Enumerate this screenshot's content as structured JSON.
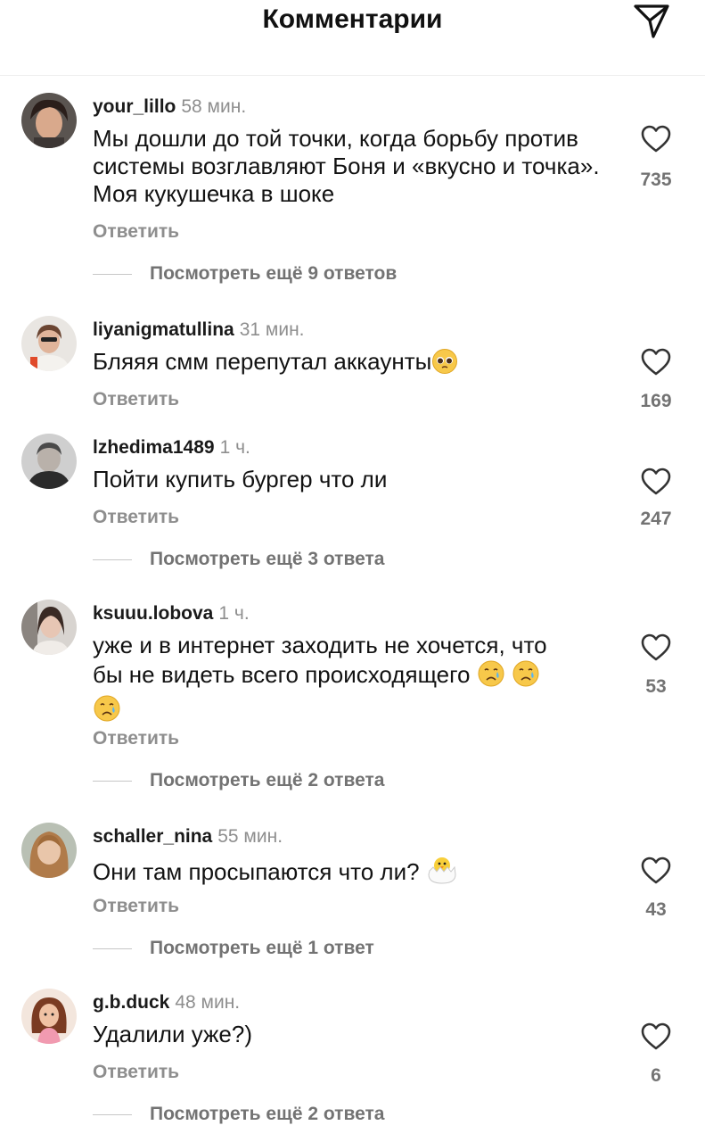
{
  "header": {
    "title": "Комментарии",
    "share_icon": "send-icon"
  },
  "reply_label": "Ответить",
  "comments": [
    {
      "username": "your_lillo",
      "time": "58 мин.",
      "text": "Мы дошли до той точки, когда борьбу против системы возглавляют  Боня и «вкусно и точка». Моя кукушечка в шоке",
      "likes": "735",
      "view_replies": "Посмотреть ещё 9 ответов"
    },
    {
      "username": "liyanigmatullina",
      "time": "31 мин.",
      "text": "Бляяя смм перепутал аккаунты",
      "emoji": "pleading-face",
      "likes": "169"
    },
    {
      "username": "lzhedima1489",
      "time": "1 ч.",
      "text": "Пойти купить бургер что ли",
      "likes": "247",
      "view_replies": "Посмотреть ещё 3 ответа"
    },
    {
      "username": "ksuuu.lobova",
      "time": "1 ч.",
      "text_line1": "уже и в интернет заходить не хочется, что",
      "text_line2": "бы не видеть всего происходящего",
      "emoji": "crying-face",
      "likes": "53",
      "view_replies": "Посмотреть ещё 2 ответа"
    },
    {
      "username": "schaller_nina",
      "time": "55 мин.",
      "text": "Они там просыпаются что ли?",
      "emoji": "hatching-chick",
      "likes": "43",
      "view_replies": "Посмотреть ещё 1 ответ"
    },
    {
      "username": "g.b.duck",
      "time": "48 мин.",
      "text": "Удалили уже?)",
      "likes": "6",
      "view_replies": "Посмотреть ещё 2 ответа"
    }
  ]
}
